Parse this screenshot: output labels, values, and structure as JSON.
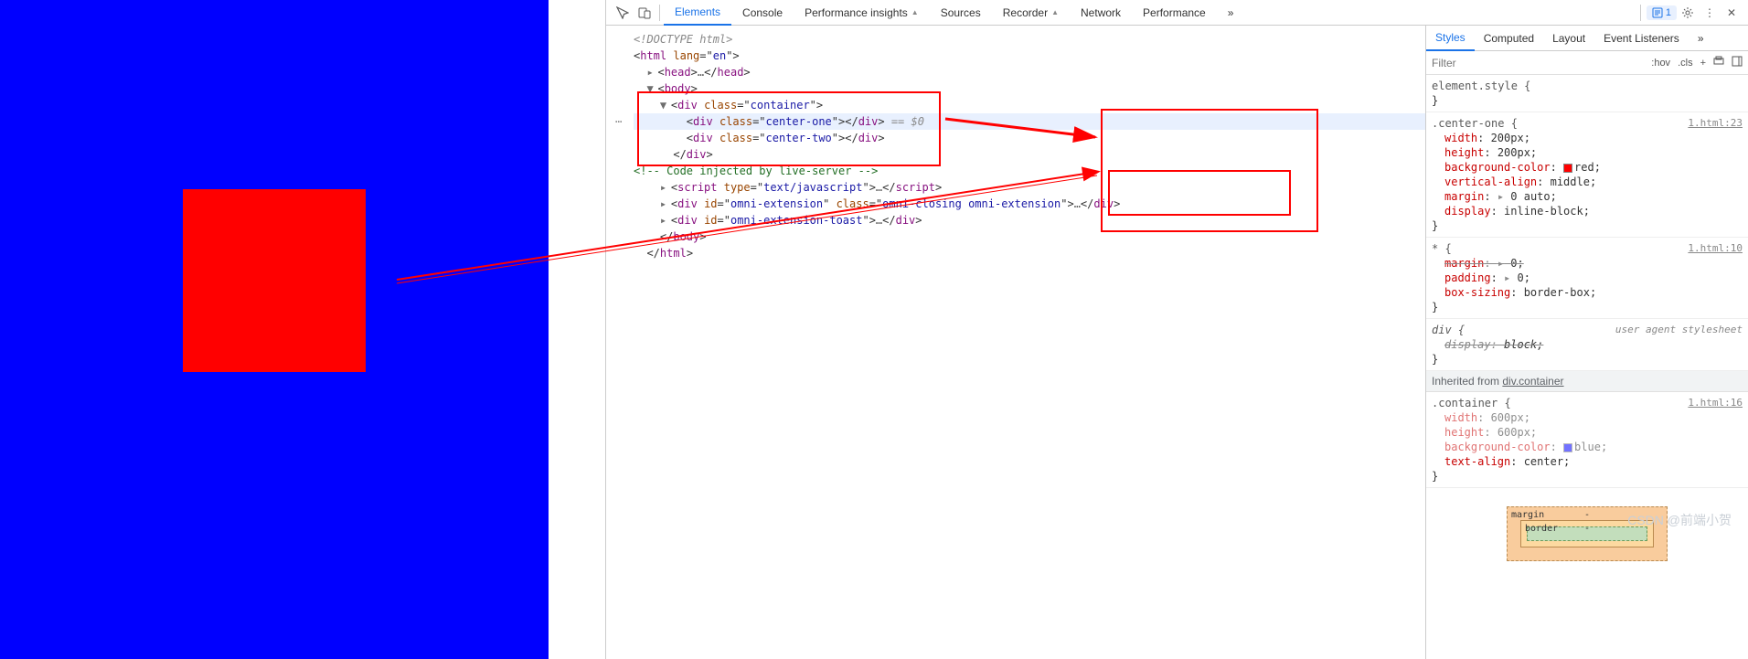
{
  "tabs": {
    "elements": "Elements",
    "console": "Console",
    "perf_insights": "Performance insights",
    "sources": "Sources",
    "recorder": "Recorder",
    "network": "Network",
    "performance": "Performance",
    "more": "»",
    "issues_count": "1"
  },
  "dom": {
    "doctype": "<!DOCTYPE html>",
    "html_open": "<html lang=\"en\">",
    "head": "<head>…</head>",
    "body_open": "<body>",
    "container_open": "<div class=\"container\">",
    "center_one": "<div class=\"center-one\"></div>",
    "selected_suffix": "== $0",
    "center_two": "<div class=\"center-two\"></div>",
    "container_close": "</div>",
    "comment": "<!-- Code injected by live-server -->",
    "script": "<script type=\"text/javascript\">…</script>",
    "ext1": "<div id=\"omni-extension\" class=\"omni-closing omni-extension\">…</div>",
    "ext2": "<div id=\"omni-extension-toast\">…</div>",
    "body_close": "</body>",
    "html_close": "</html>"
  },
  "styles_panel": {
    "tabs": {
      "styles": "Styles",
      "computed": "Computed",
      "layout": "Layout",
      "listeners": "Event Listeners",
      "more": "»"
    },
    "filter_placeholder": "Filter",
    "hov": ":hov",
    "cls": ".cls",
    "element_style": "element.style {",
    "brace_close": "}",
    "rule_center": {
      "selector": ".center-one {",
      "src": "1.html:23",
      "props": [
        {
          "n": "width",
          "v": "200px;"
        },
        {
          "n": "height",
          "v": "200px;"
        },
        {
          "n": "background-color",
          "v": "red;",
          "swatch": "#ff0000"
        },
        {
          "n": "vertical-align",
          "v": "middle;"
        },
        {
          "n": "margin",
          "v": "0 auto;",
          "arrow": true
        },
        {
          "n": "display",
          "v": "inline-block;"
        }
      ]
    },
    "rule_star": {
      "selector": "* {",
      "src": "1.html:10",
      "props": [
        {
          "n": "margin",
          "v": "0;",
          "arrow": true,
          "strike": true
        },
        {
          "n": "padding",
          "v": "0;",
          "arrow": true
        },
        {
          "n": "box-sizing",
          "v": "border-box;"
        }
      ]
    },
    "rule_div": {
      "selector": "div {",
      "ua": "user agent stylesheet",
      "props": [
        {
          "n": "display",
          "v": "block;",
          "strike": true
        }
      ]
    },
    "inherited_label": "Inherited from ",
    "inherited_sel": "div.container",
    "rule_container": {
      "selector": ".container {",
      "src": "1.html:16",
      "props": [
        {
          "n": "width",
          "v": "600px;",
          "dim": true
        },
        {
          "n": "height",
          "v": "600px;",
          "dim": true
        },
        {
          "n": "background-color",
          "v": "blue;",
          "swatch": "#0000ff",
          "dim": true
        },
        {
          "n": "text-align",
          "v": "center;"
        }
      ]
    },
    "box_model": {
      "margin": "margin",
      "border": "border",
      "dash": "-"
    }
  },
  "watermark": "CSDN @前端小贺"
}
